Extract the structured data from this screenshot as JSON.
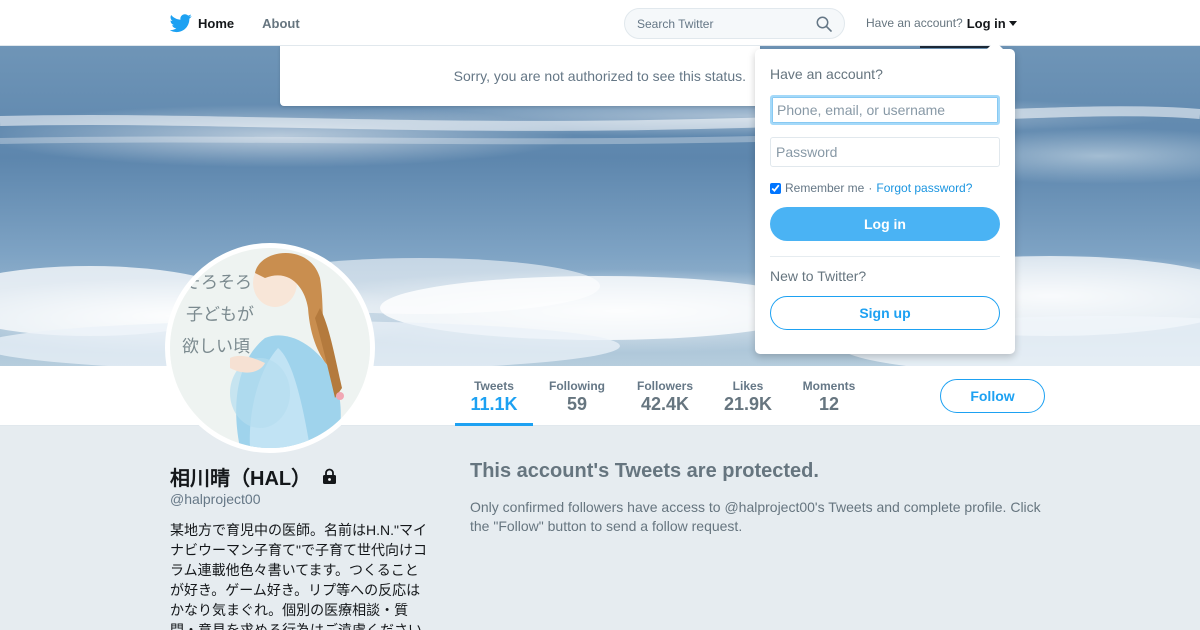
{
  "nav": {
    "logo_icon": "twitter-bird-icon",
    "home_label": "Home",
    "about_label": "About"
  },
  "search": {
    "placeholder": "Search Twitter",
    "icon": "search-icon"
  },
  "account": {
    "prompt": "Have an account?",
    "login_label": "Log in"
  },
  "status_notice": "Sorry, you are not authorized to see this status.",
  "login_dropdown": {
    "heading": "Have an account?",
    "username_placeholder": "Phone, email, or username",
    "password_placeholder": "Password",
    "remember_label": "Remember me",
    "separator": "·",
    "forgot_label": "Forgot password?",
    "remember_checked": true,
    "login_button": "Log in",
    "new_prompt": "New to Twitter?",
    "signup_button": "Sign up"
  },
  "stats": [
    {
      "label": "Tweets",
      "value": "11.1K",
      "active": true
    },
    {
      "label": "Following",
      "value": "59"
    },
    {
      "label": "Followers",
      "value": "42.4K"
    },
    {
      "label": "Likes",
      "value": "21.9K"
    },
    {
      "label": "Moments",
      "value": "12"
    }
  ],
  "follow_label": "Follow",
  "profile": {
    "name": "相川晴（HAL）",
    "handle": "@halproject00",
    "bio": "某地方で育児中の医師。名前はH.N.\"マイナビウーマン子育て\"で子育て世代向けコラム連載他色々書いてます。つくることが好き。ゲーム好き。リプ等への反応はかなり気まぐれ。個別の医療相談・質問・意見を求める行為はご遠慮ください",
    "lock_icon": "lock-icon",
    "avatar_text": [
      "そろそろ",
      "子どもが",
      "欲しい頃"
    ]
  },
  "protected": {
    "title": "This account's Tweets are protected.",
    "text": "Only confirmed followers have access to @halproject00's Tweets and complete profile. Click the \"Follow\" button to send a follow request."
  },
  "colors": {
    "accent": "#1da1f2",
    "button_fill": "#4ab3f4",
    "background": "#e6ecf0"
  }
}
